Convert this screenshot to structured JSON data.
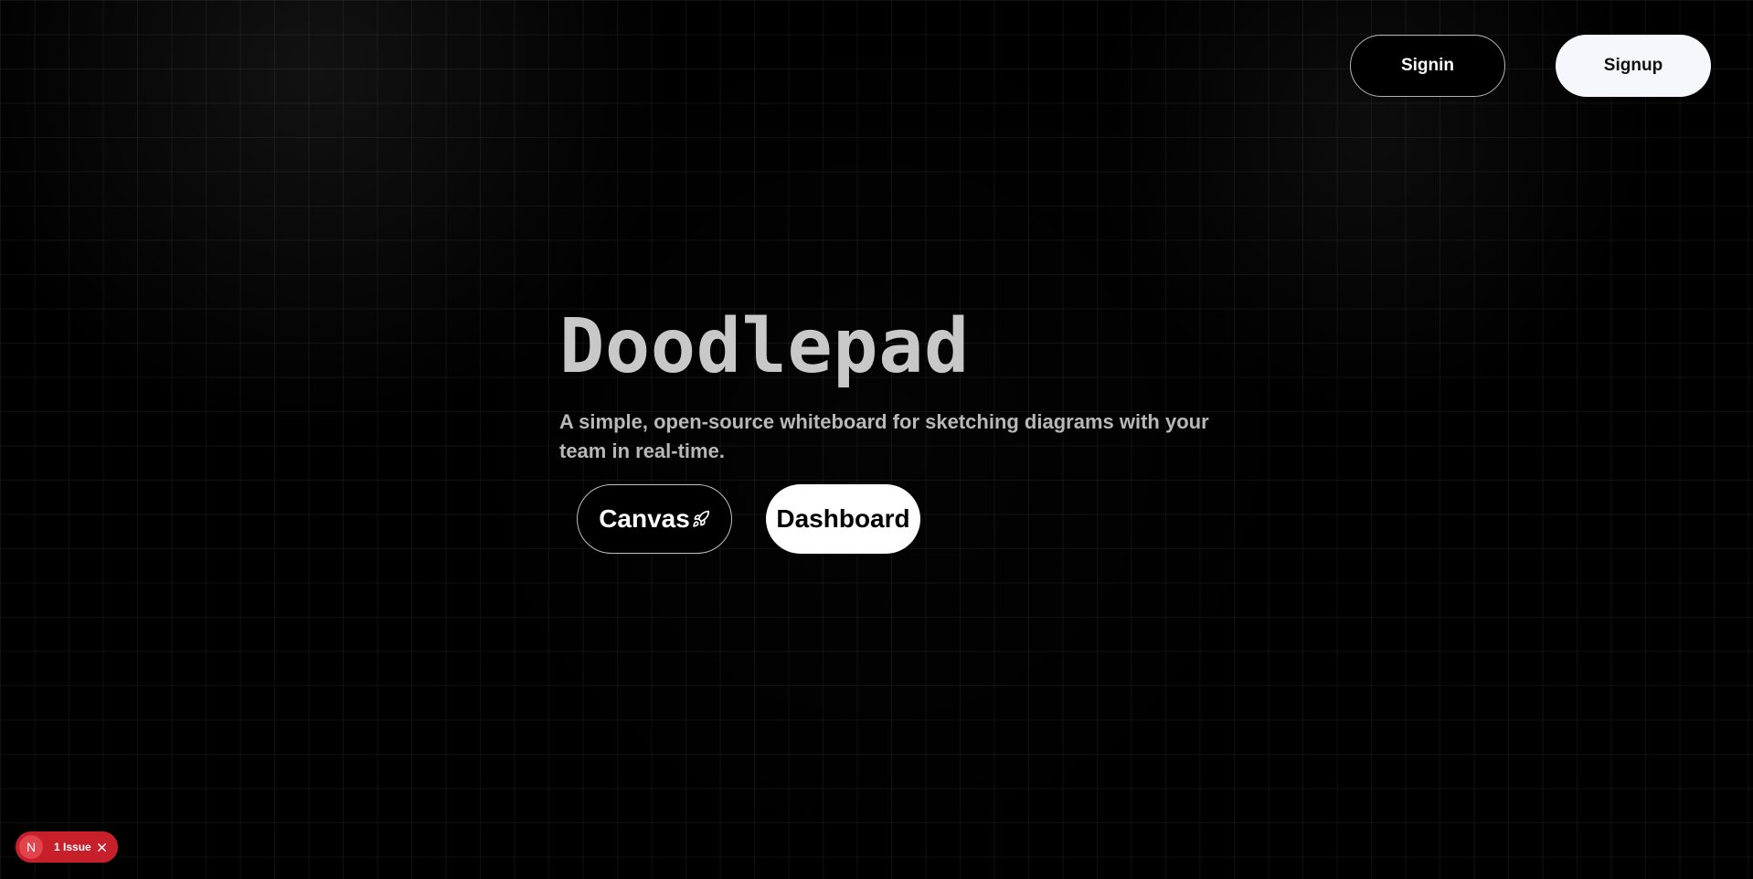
{
  "nav": {
    "signin_label": "Signin",
    "signup_label": "Signup"
  },
  "hero": {
    "title": "Doodlepad",
    "subtitle": "A simple, open-source whiteboard for sketching diagrams with your team in real-time.",
    "canvas_label": "Canvas",
    "canvas_icon": "rocket-icon",
    "dashboard_label": "Dashboard"
  },
  "dev_overlay": {
    "logo_letter": "N",
    "issue_text": "1 Issue",
    "close_icon": "close-icon"
  },
  "colors": {
    "background": "#000000",
    "title": "#c8c8c8",
    "subtitle": "#b8b8b8",
    "issue_badge": "#c8202b"
  }
}
